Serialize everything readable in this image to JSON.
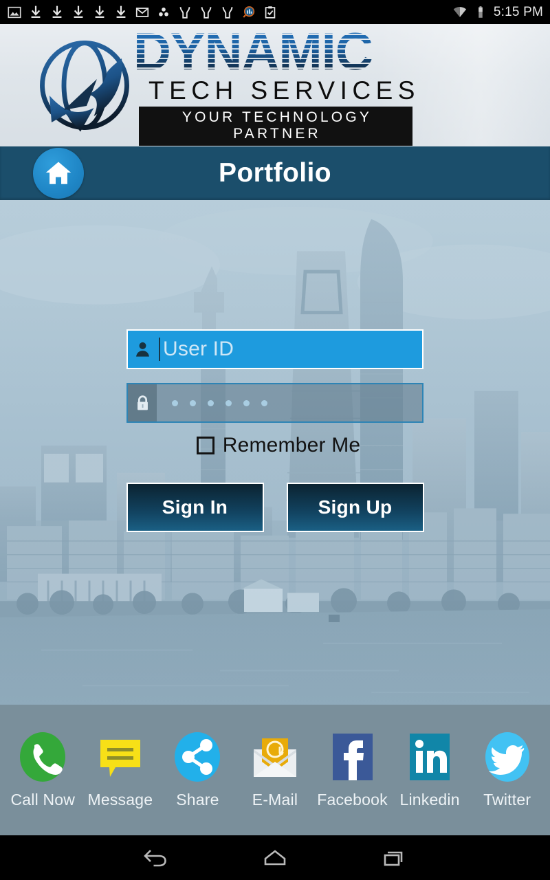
{
  "statusbar": {
    "time": "5:15 PM",
    "icons": [
      "image-icon",
      "download-icon",
      "download-icon",
      "download-icon",
      "download-icon",
      "download-icon",
      "gmail-icon",
      "three-dots-icon",
      "yelp-icon",
      "yelp-icon",
      "yelp-icon",
      "search-app-icon",
      "clipboard-check-icon"
    ],
    "right_icons": [
      "wifi-icon",
      "battery-icon"
    ]
  },
  "brand": {
    "name": "DYNAMIC",
    "subtitle": "TECH SERVICES",
    "tagline": "YOUR TECHNOLOGY PARTNER",
    "logo_icon": "globe-arrow-logo"
  },
  "titlebar": {
    "title": "Portfolio",
    "home_icon": "home-icon",
    "bg_color": "#1b4e6b"
  },
  "login": {
    "user_field": {
      "placeholder": "User ID",
      "value": "",
      "icon": "person-icon",
      "bg_color": "#1e9bde"
    },
    "password_field": {
      "placeholder": "",
      "masked_value": "••••••",
      "dot_count": 6,
      "icon": "lock-icon"
    },
    "remember": {
      "label": "Remember Me",
      "checked": false
    },
    "sign_in_label": "Sign In",
    "sign_up_label": "Sign Up"
  },
  "social": [
    {
      "label": "Call Now",
      "icon": "phone-icon",
      "color": "#34a83a"
    },
    {
      "label": "Message",
      "icon": "message-icon",
      "color": "#f7e017"
    },
    {
      "label": "Share",
      "icon": "share-icon",
      "color": "#22b0ea"
    },
    {
      "label": "E-Mail",
      "icon": "email-icon",
      "color": "#e8ab09"
    },
    {
      "label": "Facebook",
      "icon": "facebook-icon",
      "color": "#3b5998"
    },
    {
      "label": "Linkedin",
      "icon": "linkedin-icon",
      "color": "#1186a8"
    },
    {
      "label": "Twitter",
      "icon": "twitter-icon",
      "color": "#42c2f3"
    }
  ],
  "navbar": {
    "back_icon": "back-arrow-icon",
    "home_icon": "home-outline-icon",
    "recents_icon": "recents-icon"
  }
}
